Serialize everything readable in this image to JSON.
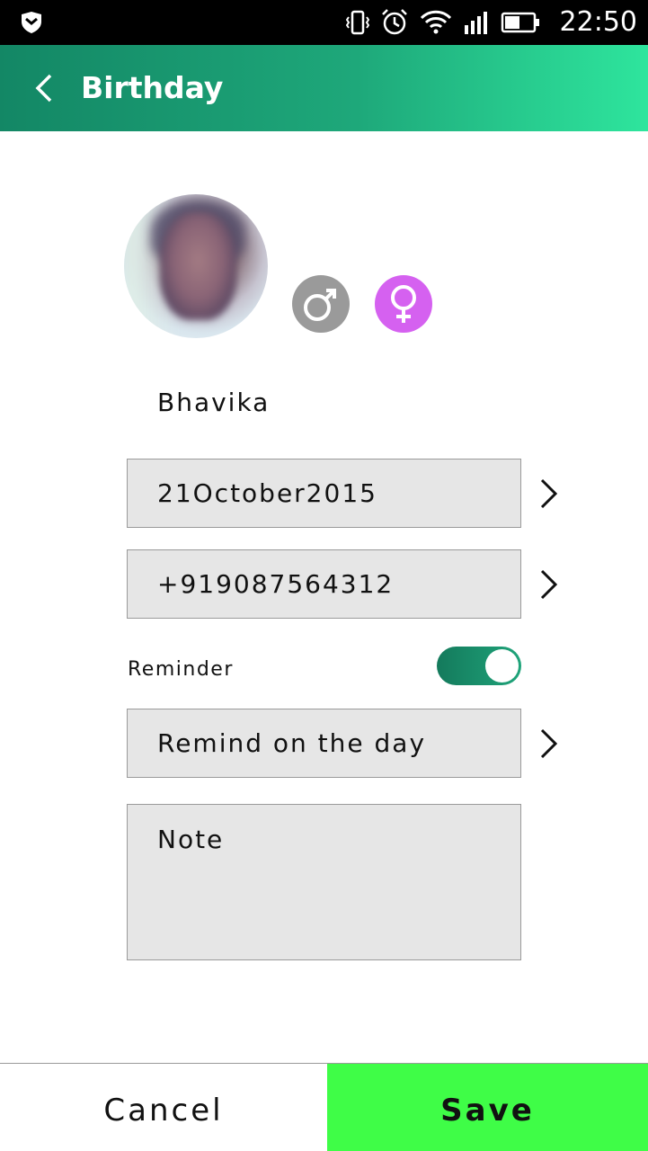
{
  "status_bar": {
    "time": "22:50",
    "icons": [
      "shield-icon",
      "vibrate-icon",
      "alarm-icon",
      "wifi-icon",
      "signal-icon",
      "battery-icon"
    ]
  },
  "app_bar": {
    "title": "Birthday",
    "back_icon": "chevron-left-icon",
    "gradient_colors": [
      "#138765",
      "#2ee59d"
    ]
  },
  "profile": {
    "name": "Bhavika",
    "gender_options": [
      {
        "name": "male",
        "icon": "male-symbol-icon",
        "color": "#9a9a9a",
        "selected": false
      },
      {
        "name": "female",
        "icon": "female-symbol-icon",
        "color": "#d561f0",
        "selected": true
      }
    ]
  },
  "fields": {
    "date": "21October2015",
    "phone": "+919087564312",
    "reminder_label": "Reminder",
    "reminder_enabled": true,
    "remind_option": "Remind on the day",
    "note_placeholder": "Note"
  },
  "actions": {
    "cancel_label": "Cancel",
    "save_label": "Save",
    "save_color": "#3ffd47"
  }
}
